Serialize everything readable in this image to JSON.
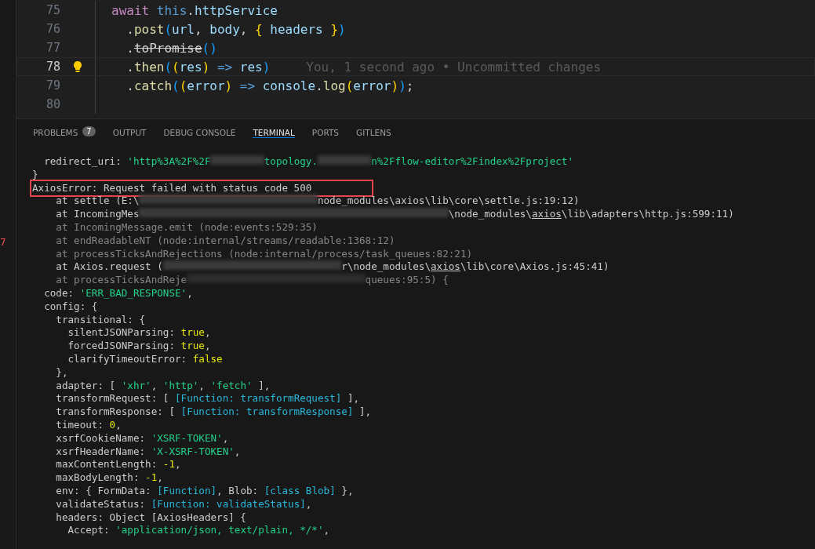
{
  "activity_badge": "7",
  "editor": {
    "lines": [
      {
        "number": "75",
        "current": false,
        "lightbulb": false,
        "segments": [
          {
            "text": "await ",
            "kind": "keyword"
          },
          {
            "text": "this",
            "kind": "this"
          },
          {
            "text": ".",
            "kind": "plain"
          },
          {
            "text": "httpService",
            "kind": "variable"
          }
        ]
      },
      {
        "number": "76",
        "current": false,
        "lightbulb": false,
        "segments": [
          {
            "text": "  .",
            "kind": "plain"
          },
          {
            "text": "post",
            "kind": "method"
          },
          {
            "text": "(",
            "kind": "bracket1"
          },
          {
            "text": "url",
            "kind": "variable"
          },
          {
            "text": ", ",
            "kind": "plain"
          },
          {
            "text": "body",
            "kind": "variable"
          },
          {
            "text": ", ",
            "kind": "plain"
          },
          {
            "text": "{ ",
            "kind": "bracket2"
          },
          {
            "text": "headers ",
            "kind": "variable"
          },
          {
            "text": "}",
            "kind": "bracket2"
          },
          {
            "text": ")",
            "kind": "bracket1"
          }
        ]
      },
      {
        "number": "77",
        "current": false,
        "lightbulb": false,
        "segments": [
          {
            "text": "  .",
            "kind": "plain"
          },
          {
            "text": "toPromise",
            "kind": "deprecated"
          },
          {
            "text": "()",
            "kind": "bracket1"
          }
        ]
      },
      {
        "number": "78",
        "current": true,
        "lightbulb": true,
        "blame": "You, 1 second ago • Uncommitted changes",
        "segments": [
          {
            "text": "  .",
            "kind": "plain"
          },
          {
            "text": "then",
            "kind": "method"
          },
          {
            "text": "(",
            "kind": "bracket1"
          },
          {
            "text": "(",
            "kind": "bracket2"
          },
          {
            "text": "res",
            "kind": "variable"
          },
          {
            "text": ") ",
            "kind": "bracket2"
          },
          {
            "text": "=> ",
            "kind": "operator"
          },
          {
            "text": "res",
            "kind": "variable"
          },
          {
            "text": ")",
            "kind": "bracket1"
          }
        ]
      },
      {
        "number": "79",
        "current": false,
        "lightbulb": false,
        "segments": [
          {
            "text": "  .",
            "kind": "plain"
          },
          {
            "text": "catch",
            "kind": "method"
          },
          {
            "text": "(",
            "kind": "bracket1"
          },
          {
            "text": "(",
            "kind": "bracket2"
          },
          {
            "text": "error",
            "kind": "variable"
          },
          {
            "text": ") ",
            "kind": "bracket2"
          },
          {
            "text": "=> ",
            "kind": "operator"
          },
          {
            "text": "console",
            "kind": "variable"
          },
          {
            "text": ".",
            "kind": "plain"
          },
          {
            "text": "log",
            "kind": "method"
          },
          {
            "text": "(",
            "kind": "bracket2"
          },
          {
            "text": "error",
            "kind": "variable"
          },
          {
            "text": ")",
            "kind": "bracket2"
          },
          {
            "text": ")",
            "kind": "bracket1"
          },
          {
            "text": ";",
            "kind": "plain"
          }
        ]
      },
      {
        "number": "80",
        "current": false,
        "lightbulb": false
      }
    ]
  },
  "panel": {
    "tabs": [
      {
        "label": "PROBLEMS",
        "selected": false,
        "badge": "7"
      },
      {
        "label": "OUTPUT",
        "selected": false
      },
      {
        "label": "DEBUG CONSOLE",
        "selected": false
      },
      {
        "label": "TERMINAL",
        "selected": true
      },
      {
        "label": "PORTS",
        "selected": false
      },
      {
        "label": "GITLENS",
        "selected": false
      }
    ],
    "terminal_lines": [
      {
        "dim": false,
        "highlighted": false,
        "segments": [
          {
            "text": "  redirect_uri: ",
            "kind": "plain"
          },
          {
            "text": "'http%3A%2F%2F",
            "kind": "string"
          },
          {
            "kind": "blur_medium"
          },
          {
            "text": "topology.",
            "kind": "string"
          },
          {
            "kind": "blur_medium"
          },
          {
            "text": "n%2Fflow-editor%2Findex%2Fproject'",
            "kind": "string"
          }
        ]
      },
      {
        "dim": false,
        "highlighted": false,
        "segments": [
          {
            "text": "}",
            "kind": "plain"
          }
        ]
      },
      {
        "dim": false,
        "highlighted": true,
        "segments": [
          {
            "text": "AxiosError: Request failed with status code 500",
            "kind": "plain"
          }
        ]
      },
      {
        "dim": false,
        "highlighted": false,
        "segments": [
          {
            "text": "    at settle (E:\\",
            "kind": "plain"
          },
          {
            "kind": "blur_long"
          },
          {
            "text": "node_modules\\axios\\lib\\core\\settle.js:19:12)",
            "kind": "plain"
          }
        ]
      },
      {
        "dim": false,
        "highlighted": false,
        "segments": [
          {
            "text": "    at IncomingMes",
            "kind": "plain"
          },
          {
            "kind": "blur_wide"
          },
          {
            "text": "\\node_modules\\",
            "kind": "plain"
          },
          {
            "text": "axios",
            "kind": "underlined"
          },
          {
            "text": "\\lib\\adapters\\http.js:599:11)",
            "kind": "plain"
          }
        ]
      },
      {
        "dim": true,
        "highlighted": false,
        "segments": [
          {
            "text": "    at IncomingMessage.emit (node:events:529:35)",
            "kind": "plain"
          }
        ]
      },
      {
        "dim": true,
        "highlighted": false,
        "segments": [
          {
            "text": "    at endReadableNT (node:internal/streams/readable:1368:12)",
            "kind": "plain"
          }
        ]
      },
      {
        "dim": true,
        "highlighted": false,
        "segments": [
          {
            "text": "    at processTicksAndRejections (node:internal/process/task_queues:82:21)",
            "kind": "plain"
          }
        ]
      },
      {
        "dim": false,
        "highlighted": false,
        "segments": [
          {
            "text": "    at Axios.request (",
            "kind": "plain"
          },
          {
            "kind": "blur_long"
          },
          {
            "text": "r\\node_modules\\",
            "kind": "plain"
          },
          {
            "text": "axios",
            "kind": "underlined"
          },
          {
            "text": "\\lib\\core\\Axios.js:45:41)",
            "kind": "plain"
          }
        ]
      },
      {
        "dim": true,
        "highlighted": false,
        "segments": [
          {
            "text": "    at processTicksAndReje",
            "kind": "plain"
          },
          {
            "kind": "blur_long"
          },
          {
            "text": "queues:95:5) {",
            "kind": "plain"
          }
        ]
      },
      {
        "dim": false,
        "highlighted": false,
        "segments": [
          {
            "text": "  code: ",
            "kind": "plain"
          },
          {
            "text": "'ERR_BAD_RESPONSE'",
            "kind": "string"
          },
          {
            "text": ",",
            "kind": "plain"
          }
        ]
      },
      {
        "dim": false,
        "highlighted": false,
        "segments": [
          {
            "text": "  config: {",
            "kind": "plain"
          }
        ]
      },
      {
        "dim": false,
        "highlighted": false,
        "segments": [
          {
            "text": "    transitional: {",
            "kind": "plain"
          }
        ]
      },
      {
        "dim": false,
        "highlighted": false,
        "segments": [
          {
            "text": "      silentJSONParsing: ",
            "kind": "plain"
          },
          {
            "text": "true",
            "kind": "literal"
          },
          {
            "text": ",",
            "kind": "plain"
          }
        ]
      },
      {
        "dim": false,
        "highlighted": false,
        "segments": [
          {
            "text": "      forcedJSONParsing: ",
            "kind": "plain"
          },
          {
            "text": "true",
            "kind": "literal"
          },
          {
            "text": ",",
            "kind": "plain"
          }
        ]
      },
      {
        "dim": false,
        "highlighted": false,
        "segments": [
          {
            "text": "      clarifyTimeoutError: ",
            "kind": "plain"
          },
          {
            "text": "false",
            "kind": "literal"
          }
        ]
      },
      {
        "dim": false,
        "highlighted": false,
        "segments": [
          {
            "text": "    },",
            "kind": "plain"
          }
        ]
      },
      {
        "dim": false,
        "highlighted": false,
        "segments": [
          {
            "text": "    adapter: [ ",
            "kind": "plain"
          },
          {
            "text": "'xhr'",
            "kind": "string"
          },
          {
            "text": ", ",
            "kind": "plain"
          },
          {
            "text": "'http'",
            "kind": "string"
          },
          {
            "text": ", ",
            "kind": "plain"
          },
          {
            "text": "'fetch'",
            "kind": "string"
          },
          {
            "text": " ],",
            "kind": "plain"
          }
        ]
      },
      {
        "dim": false,
        "highlighted": false,
        "segments": [
          {
            "text": "    transformRequest: [ ",
            "kind": "plain"
          },
          {
            "text": "[Function: transformRequest]",
            "kind": "function"
          },
          {
            "text": " ],",
            "kind": "plain"
          }
        ]
      },
      {
        "dim": false,
        "highlighted": false,
        "segments": [
          {
            "text": "    transformResponse: [ ",
            "kind": "plain"
          },
          {
            "text": "[Function: transformResponse]",
            "kind": "function"
          },
          {
            "text": " ],",
            "kind": "plain"
          }
        ]
      },
      {
        "dim": false,
        "highlighted": false,
        "segments": [
          {
            "text": "    timeout: ",
            "kind": "plain"
          },
          {
            "text": "0",
            "kind": "literal"
          },
          {
            "text": ",",
            "kind": "plain"
          }
        ]
      },
      {
        "dim": false,
        "highlighted": false,
        "segments": [
          {
            "text": "    xsrfCookieName: ",
            "kind": "plain"
          },
          {
            "text": "'XSRF-TOKEN'",
            "kind": "string"
          },
          {
            "text": ",",
            "kind": "plain"
          }
        ]
      },
      {
        "dim": false,
        "highlighted": false,
        "segments": [
          {
            "text": "    xsrfHeaderName: ",
            "kind": "plain"
          },
          {
            "text": "'X-XSRF-TOKEN'",
            "kind": "string"
          },
          {
            "text": ",",
            "kind": "plain"
          }
        ]
      },
      {
        "dim": false,
        "highlighted": false,
        "segments": [
          {
            "text": "    maxContentLength: ",
            "kind": "plain"
          },
          {
            "text": "-1",
            "kind": "literal"
          },
          {
            "text": ",",
            "kind": "plain"
          }
        ]
      },
      {
        "dim": false,
        "highlighted": false,
        "segments": [
          {
            "text": "    maxBodyLength: ",
            "kind": "plain"
          },
          {
            "text": "-1",
            "kind": "literal"
          },
          {
            "text": ",",
            "kind": "plain"
          }
        ]
      },
      {
        "dim": false,
        "highlighted": false,
        "segments": [
          {
            "text": "    env: { FormData: ",
            "kind": "plain"
          },
          {
            "text": "[Function]",
            "kind": "function"
          },
          {
            "text": ", Blob: ",
            "kind": "plain"
          },
          {
            "text": "[class Blob]",
            "kind": "function"
          },
          {
            "text": " },",
            "kind": "plain"
          }
        ]
      },
      {
        "dim": false,
        "highlighted": false,
        "segments": [
          {
            "text": "    validateStatus: ",
            "kind": "plain"
          },
          {
            "text": "[Function: validateStatus]",
            "kind": "function"
          },
          {
            "text": ",",
            "kind": "plain"
          }
        ]
      },
      {
        "dim": false,
        "highlighted": false,
        "segments": [
          {
            "text": "    headers: Object [AxiosHeaders] {",
            "kind": "plain"
          }
        ]
      },
      {
        "dim": false,
        "highlighted": false,
        "segments": [
          {
            "text": "      Accept: ",
            "kind": "plain"
          },
          {
            "text": "'application/json, text/plain, */*'",
            "kind": "string"
          },
          {
            "text": ",",
            "kind": "plain"
          }
        ]
      }
    ]
  }
}
